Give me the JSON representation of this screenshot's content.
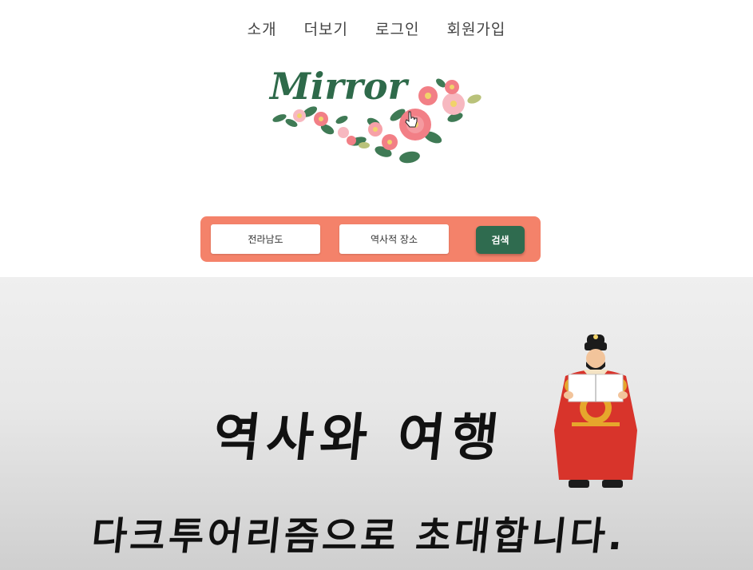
{
  "nav": {
    "items": [
      "소개",
      "더보기",
      "로그인",
      "회원가입"
    ]
  },
  "logo": {
    "text": "Mirror"
  },
  "search": {
    "region_value": "전라남도",
    "category_value": "역사적 장소",
    "button_label": "검색"
  },
  "hero": {
    "title": "역사와 여행",
    "subtitle": "다크투어리즘으로 초대합니다."
  },
  "colors": {
    "search_bar": "#f4826a",
    "search_button": "#2f6b4f",
    "logo_text": "#2e6a4a",
    "king_robe": "#d8342b"
  }
}
